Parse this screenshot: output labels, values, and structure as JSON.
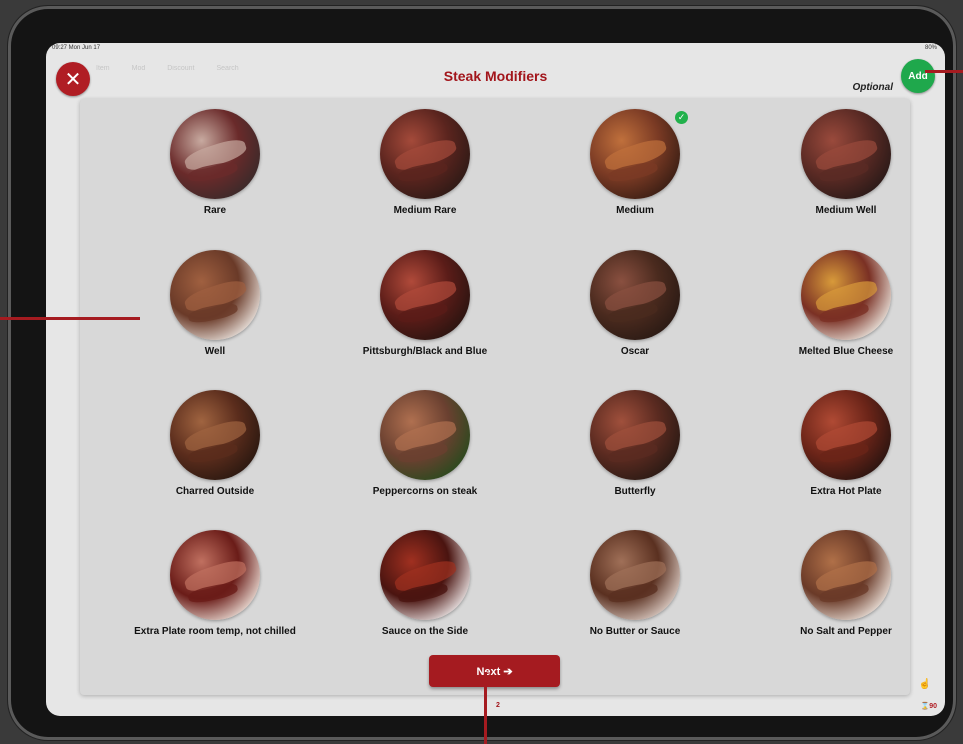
{
  "status": {
    "time": "09:27  Mon Jun 17",
    "battery": "80%"
  },
  "background_toolbar": [
    "Item",
    "Mod",
    "Discount",
    "Search"
  ],
  "header": {
    "title": "Steak Modifiers",
    "close_label": "✕",
    "optional": "Optional",
    "add_label": "Add"
  },
  "modifiers": [
    {
      "label": "Rare",
      "selected": false,
      "colors": [
        "#6a2a2a",
        "#c8aaa0",
        "#3a2a2a"
      ]
    },
    {
      "label": "Medium Rare",
      "selected": false,
      "colors": [
        "#5a241e",
        "#a44a3a",
        "#2e1a16"
      ]
    },
    {
      "label": "Medium",
      "selected": true,
      "colors": [
        "#7a3a24",
        "#c0703c",
        "#3a1e14"
      ]
    },
    {
      "label": "Medium Well",
      "selected": false,
      "colors": [
        "#5a2a24",
        "#9a4a3c",
        "#2a1a18"
      ]
    },
    {
      "label": "Well",
      "selected": false,
      "colors": [
        "#6a3a28",
        "#a06040",
        "#e8e0da"
      ]
    },
    {
      "label": "Pittsburgh/Black and Blue",
      "selected": false,
      "colors": [
        "#5a1c18",
        "#b04a3a",
        "#2a1410"
      ]
    },
    {
      "label": "Oscar",
      "selected": false,
      "colors": [
        "#4a2a1e",
        "#8a5040",
        "#2a1a14"
      ]
    },
    {
      "label": "Melted Blue Cheese",
      "selected": false,
      "colors": [
        "#7a3024",
        "#d89a3a",
        "#e8e0d8"
      ]
    },
    {
      "label": "Charred Outside",
      "selected": false,
      "colors": [
        "#5a2c1c",
        "#a06440",
        "#2a1810"
      ]
    },
    {
      "label": "Peppercorns on steak",
      "selected": false,
      "colors": [
        "#6a4030",
        "#b07050",
        "#2a4a1e"
      ]
    },
    {
      "label": "Butterfly",
      "selected": false,
      "colors": [
        "#5a2a20",
        "#a0503c",
        "#2a1a14"
      ]
    },
    {
      "label": "Extra Hot Plate",
      "selected": false,
      "colors": [
        "#6a2418",
        "#b04a34",
        "#2a1410"
      ]
    },
    {
      "label": "Extra Plate room temp, not chilled",
      "selected": false,
      "colors": [
        "#6a1c18",
        "#c07060",
        "#e8d8d0"
      ]
    },
    {
      "label": "Sauce on the Side",
      "selected": false,
      "colors": [
        "#4a1410",
        "#a03020",
        "#e8e0e0"
      ]
    },
    {
      "label": "No Butter or Sauce",
      "selected": false,
      "colors": [
        "#5a3020",
        "#a07058",
        "#d8c8c0"
      ]
    },
    {
      "label": "No Salt and Pepper",
      "selected": false,
      "colors": [
        "#6a3a28",
        "#b07048",
        "#e8ddd5"
      ]
    }
  ],
  "next_label": "Next ➔",
  "footer": {
    "page": "2",
    "timer": "⌛90"
  },
  "theme": {
    "accent": "#a51b20",
    "add": "#1fa84c"
  }
}
